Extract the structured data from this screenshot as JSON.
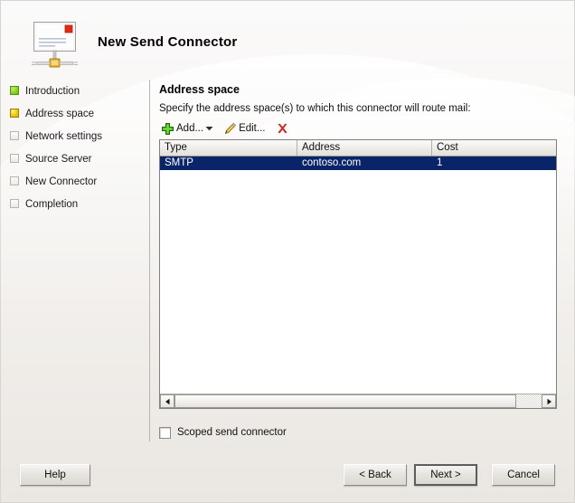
{
  "window": {
    "title": "New Send Connector",
    "icon": "send-connector-icon"
  },
  "sidebar": {
    "items": [
      {
        "label": "Introduction",
        "state": "done"
      },
      {
        "label": "Address space",
        "state": "current"
      },
      {
        "label": "Network settings",
        "state": "todo"
      },
      {
        "label": "Source Server",
        "state": "todo"
      },
      {
        "label": "New Connector",
        "state": "todo"
      },
      {
        "label": "Completion",
        "state": "todo"
      }
    ]
  },
  "content": {
    "heading": "Address space",
    "instruction": "Specify the address space(s) to which this connector will route mail:",
    "toolbar": {
      "add_label": "Add...",
      "add_icon": "plus-icon",
      "add_caret_icon": "chevron-down-icon",
      "edit_label": "Edit...",
      "edit_icon": "pencil-icon",
      "delete_icon": "red-x-icon"
    },
    "list": {
      "columns": [
        "Type",
        "Address",
        "Cost"
      ],
      "rows": [
        {
          "type": "SMTP",
          "address": "contoso.com",
          "cost": "1",
          "selected": true
        }
      ],
      "hscroll": {
        "left_arrow": "◀",
        "right_arrow": "▶"
      }
    },
    "scoped": {
      "label": "Scoped send connector",
      "checked": false
    }
  },
  "footer": {
    "help": "Help",
    "back": "< Back",
    "next": "Next >",
    "cancel": "Cancel"
  },
  "colors": {
    "selection": "#0a246a",
    "step_done": "#8ddb2a",
    "step_current": "#f4cf19",
    "add_icon": "#3fab1a",
    "delete_icon": "#c8322b",
    "window_bg": "#ece9e4"
  }
}
